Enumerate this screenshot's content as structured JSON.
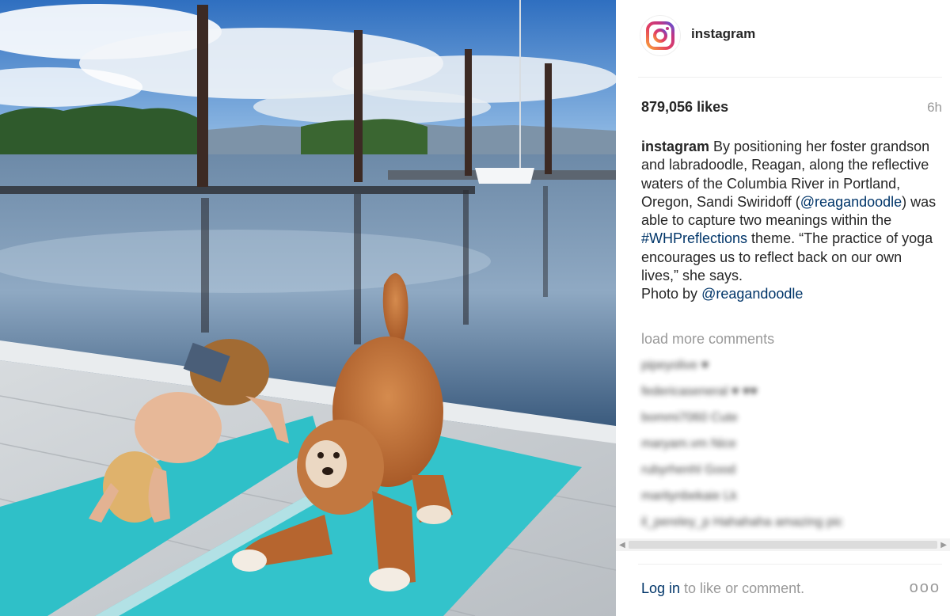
{
  "photo": {
    "description_icon": "photo-image"
  },
  "header": {
    "username": "instagram",
    "avatar_icon": "instagram-logo-icon"
  },
  "stats": {
    "likes": "879,056 likes",
    "time": "6h"
  },
  "caption": {
    "user": "instagram",
    "text1": " By positioning her foster grandson and labradoodle, Reagan, along the reflective waters of the Columbia River in Portland, Oregon, Sandi Swiridoff (",
    "mention1": "@reagandoodle",
    "text2": ") was able to capture two meanings within the ",
    "hashtag": "#WHPreflections",
    "text3": " theme. “The practice of yoga encourages us to reflect back on our own lives,” she says.",
    "text4": "Photo by ",
    "mention2": "@reagandoodle"
  },
  "comments": {
    "load_more": "load more comments",
    "items": [
      {
        "text": "pipeyolive ♥"
      },
      {
        "text": "federicaseneral ♥ ♥♥"
      },
      {
        "text": "bommi7060 Cute"
      },
      {
        "text": "maryam.vm Nice"
      },
      {
        "text": "rubyrhenhl Good"
      },
      {
        "text": "maritynbekaie Lk"
      },
      {
        "text": "il_pereley_p Hahahaha amazing pic"
      }
    ]
  },
  "footer": {
    "login": "Log in",
    "rest": " to like or comment.",
    "more": "ooo"
  },
  "colors": {
    "link": "#003569",
    "muted": "#999999",
    "mat": "#2fc0c8",
    "sky": "#3f7ec9"
  }
}
